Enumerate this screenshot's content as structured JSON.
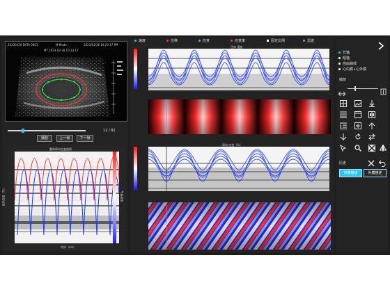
{
  "window": {
    "background": "#1e1e1e",
    "panel": "#232323",
    "accent_blue": "#1b39ff",
    "accent_red": "#ff2b2b",
    "accent_cyan": "#2ec4f0"
  },
  "ultrasound": {
    "header_id": "20230228 DATA 0001",
    "header_mode": "M-Mode",
    "header_time": "2023/02/28 10:23:17 PM",
    "header_sub": "MT 2023-02-28 10:23:17",
    "frame_text": "12 / 82",
    "buttons": {
      "play": "播放",
      "prev": "上一帧",
      "next": "下一帧"
    }
  },
  "strain_plot": {
    "title": "整体周向应变曲线",
    "ylabel": "周向应变（%）",
    "xlabel": "时间（ms）",
    "right_axis_label": "节段应变"
  },
  "toolbar": {
    "items": [
      {
        "label": "速度",
        "color": "#2ec4f0"
      },
      {
        "label": "位移",
        "color": "#ff3b3b"
      },
      {
        "label": "应变",
        "color": "#2ec4f0"
      },
      {
        "label": "应变率",
        "color": "#ff3b3b"
      },
      {
        "label": "固定比例",
        "color": "#ffffff"
      },
      {
        "label": "滤波",
        "color": "#2ec4f0"
      }
    ]
  },
  "chart_top": {
    "title": "径向 速度"
  },
  "chart_bottom": {
    "title": "周向 应变（%）"
  },
  "sidebar": {
    "options": [
      {
        "label": "长轴",
        "color": "#2ec4f0"
      },
      {
        "label": "短轴",
        "color": "#ffffff"
      },
      {
        "label": "自由曲线",
        "color": "#ffffff"
      },
      {
        "label": "心内膜+心外膜",
        "color": "#ffffff"
      }
    ],
    "zoom_label": "缩放",
    "history_label": "历史",
    "export_btn": "内膜描述",
    "import_btn": "外膜描述"
  },
  "icons": [
    "collapse-arrow-icon",
    "zoom-arrows-icon",
    "zoom-slider-icon",
    "grid-icon",
    "image-icon",
    "arrow-down-icon",
    "list-icon",
    "window-icon",
    "split-view-icon",
    "indent-icon",
    "add-window-icon",
    "arrow-up-icon",
    "sort-down-icon",
    "refresh-icon",
    "swap-icon",
    "cursor-icon",
    "search-icon",
    "cross-select-icon",
    "flip-icon",
    "close-x-icon",
    "undo-icon"
  ]
}
